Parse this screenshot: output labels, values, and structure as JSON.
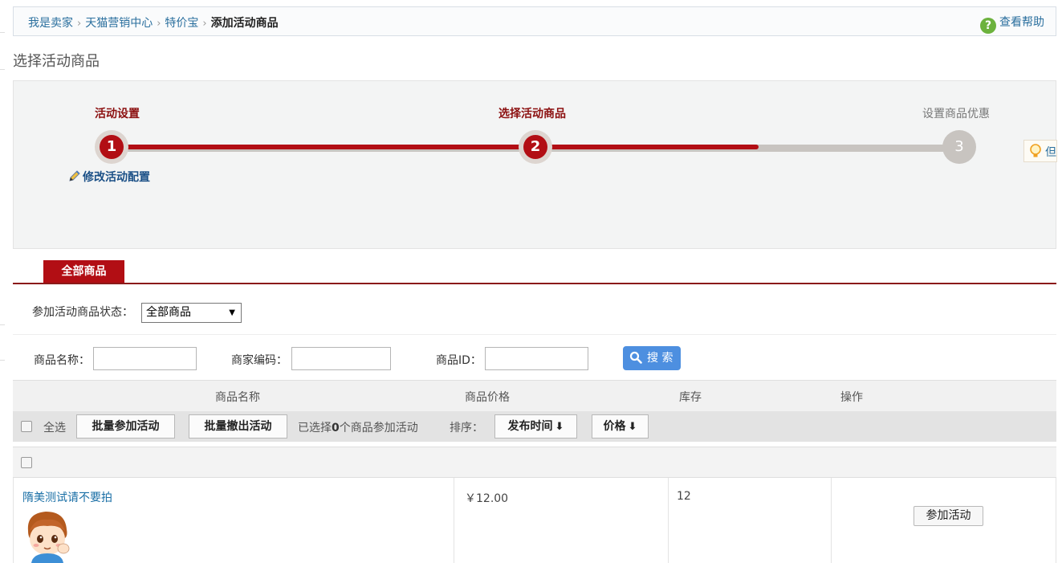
{
  "breadcrumb": {
    "items": [
      "我是卖家",
      "天猫营销中心",
      "特价宝"
    ],
    "current": "添加活动商品",
    "separator": "›"
  },
  "help": {
    "label": "查看帮助",
    "icon": "help-question-icon"
  },
  "page_title": "选择活动商品",
  "steps": [
    {
      "label": "活动设置",
      "number": "1",
      "state": "done"
    },
    {
      "label": "选择活动商品",
      "number": "2",
      "state": "current"
    },
    {
      "label": "设置商品优惠",
      "number": "3",
      "state": "todo"
    }
  ],
  "progress_fraction": 0.76,
  "edit_config": {
    "label": "修改活动配置",
    "icon": "pencil-icon"
  },
  "tip": {
    "text": "但",
    "icon": "lightbulb-icon"
  },
  "tabs": [
    {
      "label": "全部商品",
      "active": true
    }
  ],
  "filters": {
    "status_label": "参加活动商品状态：",
    "status_value": "全部商品",
    "name_label": "商品名称：",
    "code_label": "商家编码：",
    "id_label": "商品ID：",
    "search_label": "搜 索"
  },
  "table": {
    "headers": [
      "商品名称",
      "商品价格",
      "库存",
      "操作"
    ],
    "toolbar": {
      "select_all": "全选",
      "batch_join": "批量参加活动",
      "batch_quit": "批量撤出活动",
      "selected_prefix": "已选择",
      "selected_count": "0",
      "selected_suffix": "个商品参加活动",
      "sort_label": "排序：",
      "sort_time": "发布时间",
      "sort_price": "价格"
    },
    "rows": [
      {
        "name": "隋美测试请不要拍",
        "price": "￥12.00",
        "stock": "12",
        "action": "参加活动"
      }
    ]
  },
  "colors": {
    "accent": "#b20e14",
    "link": "#2a6f9e",
    "search_button": "#4d8fe0"
  }
}
